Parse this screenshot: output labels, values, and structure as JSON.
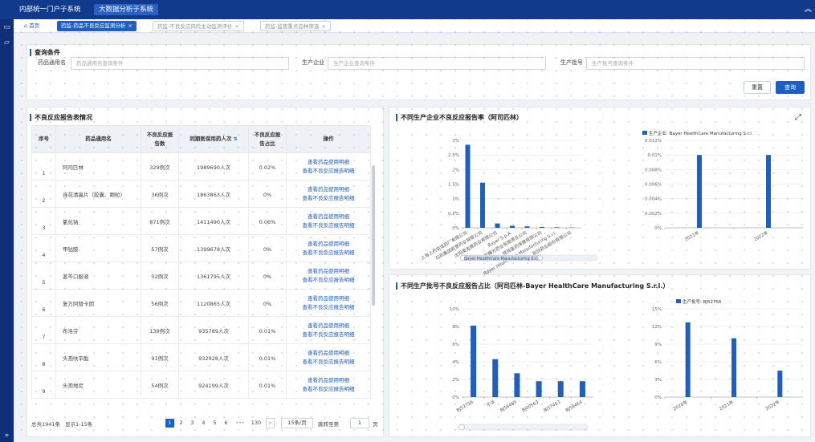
{
  "topbar": {
    "sys1": "内部统一门户子系统",
    "sys2": "大数据分析子系统"
  },
  "tabs": {
    "home": "首页",
    "t1": "药监-药品不良反应监测分析",
    "t2": "药监-不良反应风险主动监测评价",
    "t3": "药监-监管重点品种筛选"
  },
  "query": {
    "title": "查询条件",
    "drug_label": "药品通用名",
    "drug_ph": "药品通用名查询条件",
    "mfr_label": "生产企业",
    "mfr_ph": "生产企业查询条件",
    "batch_label": "生产批号",
    "batch_ph": "生产批号查询条件",
    "reset": "重置",
    "search": "查询"
  },
  "report": {
    "title": "不良反应报告表情况",
    "headers": {
      "no": "序号",
      "name": "药品通用名",
      "count_a": "不良反应报",
      "count_b": "告数",
      "users": "同期医保用药人次",
      "ratio_a": "不良反应报",
      "ratio_b": "告占比",
      "op": "操作"
    },
    "op1": "查看药品使用明细",
    "op2": "查看不良反应报告明细",
    "rows": [
      {
        "no": "1",
        "name": "阿司匹林",
        "count": "329例次",
        "users": "1989690人次",
        "ratio": "0.02%"
      },
      {
        "no": "2",
        "name": "连花清瘟片（胶囊、颗粒）",
        "count": "36例次",
        "users": "1863863人次",
        "ratio": "0%"
      },
      {
        "no": "3",
        "name": "氯化钠",
        "count": "871例次",
        "users": "1411490人次",
        "ratio": "0.06%"
      },
      {
        "no": "4",
        "name": "甲钴胺",
        "count": "57例次",
        "users": "1399678人次",
        "ratio": "0%"
      },
      {
        "no": "5",
        "name": "蓝芩口服液",
        "count": "32例次",
        "users": "1361795人次",
        "ratio": "0%"
      },
      {
        "no": "6",
        "name": "复方阿替卡因",
        "count": "56例次",
        "users": "1120865人次",
        "ratio": "0%"
      },
      {
        "no": "7",
        "name": "布洛芬",
        "count": "139例次",
        "users": "935789人次",
        "ratio": "0.01%"
      },
      {
        "no": "8",
        "name": "头孢呋辛酯",
        "count": "91例次",
        "users": "932928人次",
        "ratio": "0.01%"
      },
      {
        "no": "9",
        "name": "头孢地尼",
        "count": "54例次",
        "users": "924199人次",
        "ratio": "0.01%"
      }
    ],
    "pager": {
      "total": "总共1941条",
      "range": "显示1-15条",
      "pages": [
        "1",
        "2",
        "3",
        "4",
        "5",
        "6"
      ],
      "ellipsis": "•••",
      "last": "130",
      "per": "15条/页",
      "jump": "跳转至第",
      "jump_val": "1",
      "page_unit": "页",
      "prev": "<",
      "next": ">"
    }
  },
  "chart1": {
    "title": "不同生产企业不良反应报告率（阿司匹林）",
    "expand_icon": "expand-icon"
  },
  "chart2": {
    "title": "不同生产批号不良反应报告占比（阿司匹林-Bayer HealthCare Manufacturing S.r.l.）"
  },
  "colors": {
    "primary": "#1f5fbf",
    "topbar": "#123a8c",
    "bar": "#1f5fbf"
  },
  "chart_data": [
    {
      "type": "bar",
      "ylim": [
        0,
        3
      ],
      "yticks": [
        "0%",
        "0.5%",
        "1%",
        "1.5%",
        "2%",
        "2.5%",
        "3%"
      ],
      "categories": [
        "上海上药信谊药厂有限公司",
        "石药集团欧意药业有限公司",
        "沈阳奥吉娜药业有限公司",
        "Bayer S.p.A.",
        "北京曙光药业有限责任公司",
        "拜耳医药保健有限公司",
        "Bayer HealthCare Manufacturing S.r.l.",
        "辰欣药业股份有限公司"
      ],
      "values": [
        2.85,
        1.55,
        0.15,
        0.07,
        0.05,
        0.03,
        0.02,
        0.01
      ],
      "slider_label": "Bayer HealthCare Manufacturing S.r.l."
    },
    {
      "type": "bar",
      "legend": "生产企业: Bayer HealthCare Manufacturing S.r.l.",
      "ylim": [
        0,
        0.012
      ],
      "yticks": [
        "0%",
        "0.002%",
        "0.004%",
        "0.006%",
        "0.008%",
        "0.01%",
        "0.012%"
      ],
      "categories": [
        "2021年",
        "2022年"
      ],
      "values": [
        0.01,
        0.01
      ]
    },
    {
      "type": "bar",
      "ylim": [
        0,
        10
      ],
      "yticks": [
        "0%",
        "2%",
        "4%",
        "6%",
        "8%",
        "10%"
      ],
      "categories": [
        "BJ52756",
        "不详",
        "BJ58465",
        "BJ00563",
        "BJ57453",
        "BJ58464"
      ],
      "values": [
        8.1,
        4.3,
        2.7,
        1.8,
        1.8,
        1.8
      ]
    },
    {
      "type": "bar",
      "legend": "生产批号: BJ52756",
      "ylim": [
        0,
        15
      ],
      "yticks": [
        "0%",
        "3%",
        "6%",
        "9%",
        "12%",
        "15%"
      ],
      "categories": [
        "2020年",
        "2021年",
        "2022年"
      ],
      "values": [
        12.7,
        10.0,
        4.5
      ]
    }
  ]
}
